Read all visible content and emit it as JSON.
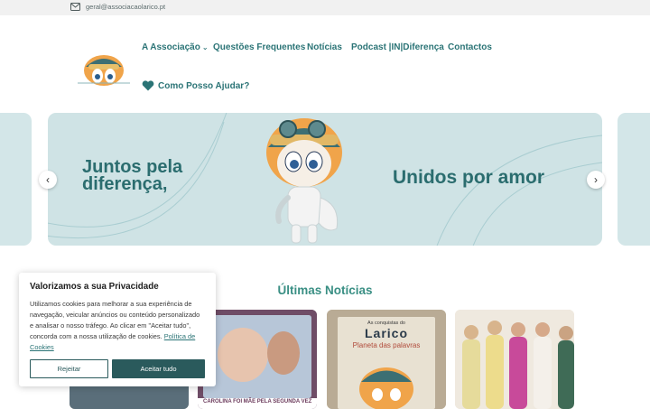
{
  "topbar": {
    "email": "geral@associacaolarico.pt"
  },
  "nav": {
    "items": [
      {
        "label": "A Associação",
        "has_dropdown": true
      },
      {
        "label": "Questões Frequentes"
      },
      {
        "label": "Notícias"
      },
      {
        "label": "Podcast |IN|Diferença"
      },
      {
        "label": "Contactos"
      }
    ],
    "help_label": "Como Posso Ajudar?"
  },
  "hero": {
    "left_text": "Juntos pela diferença,",
    "left_line1": "Juntos pela",
    "left_line2": "diferença,",
    "right_text": "Unidos por amor",
    "prev_icon": "‹",
    "next_icon": "›"
  },
  "news": {
    "title": "Últimas Notícias"
  },
  "cards": [
    {
      "caption": ""
    },
    {
      "caption": "CAROLINA FOI MÃE PELA SEGUNDA VEZ"
    },
    {
      "book_title": "As conquistas do",
      "book_name": "Larico",
      "book_sub": "Planeta das palavras"
    },
    {
      "caption": ""
    }
  ],
  "cookie": {
    "title": "Valorizamos a sua Privacidade",
    "body": "Utilizamos cookies para melhorar a sua experiência de navegação, veicular anúncios ou conteúdo personalizado e analisar o nosso tráfego. Ao clicar em \"Aceitar tudo\", concorda com a nossa utilização de cookies.",
    "policy_link": "Política de Cookies",
    "reject_label": "Rejeitar",
    "accept_label": "Aceitar tudo"
  },
  "colors": {
    "brand": "#2b7476",
    "hero_bg": "#cfe3e5",
    "button_dark": "#2a5a5c"
  }
}
